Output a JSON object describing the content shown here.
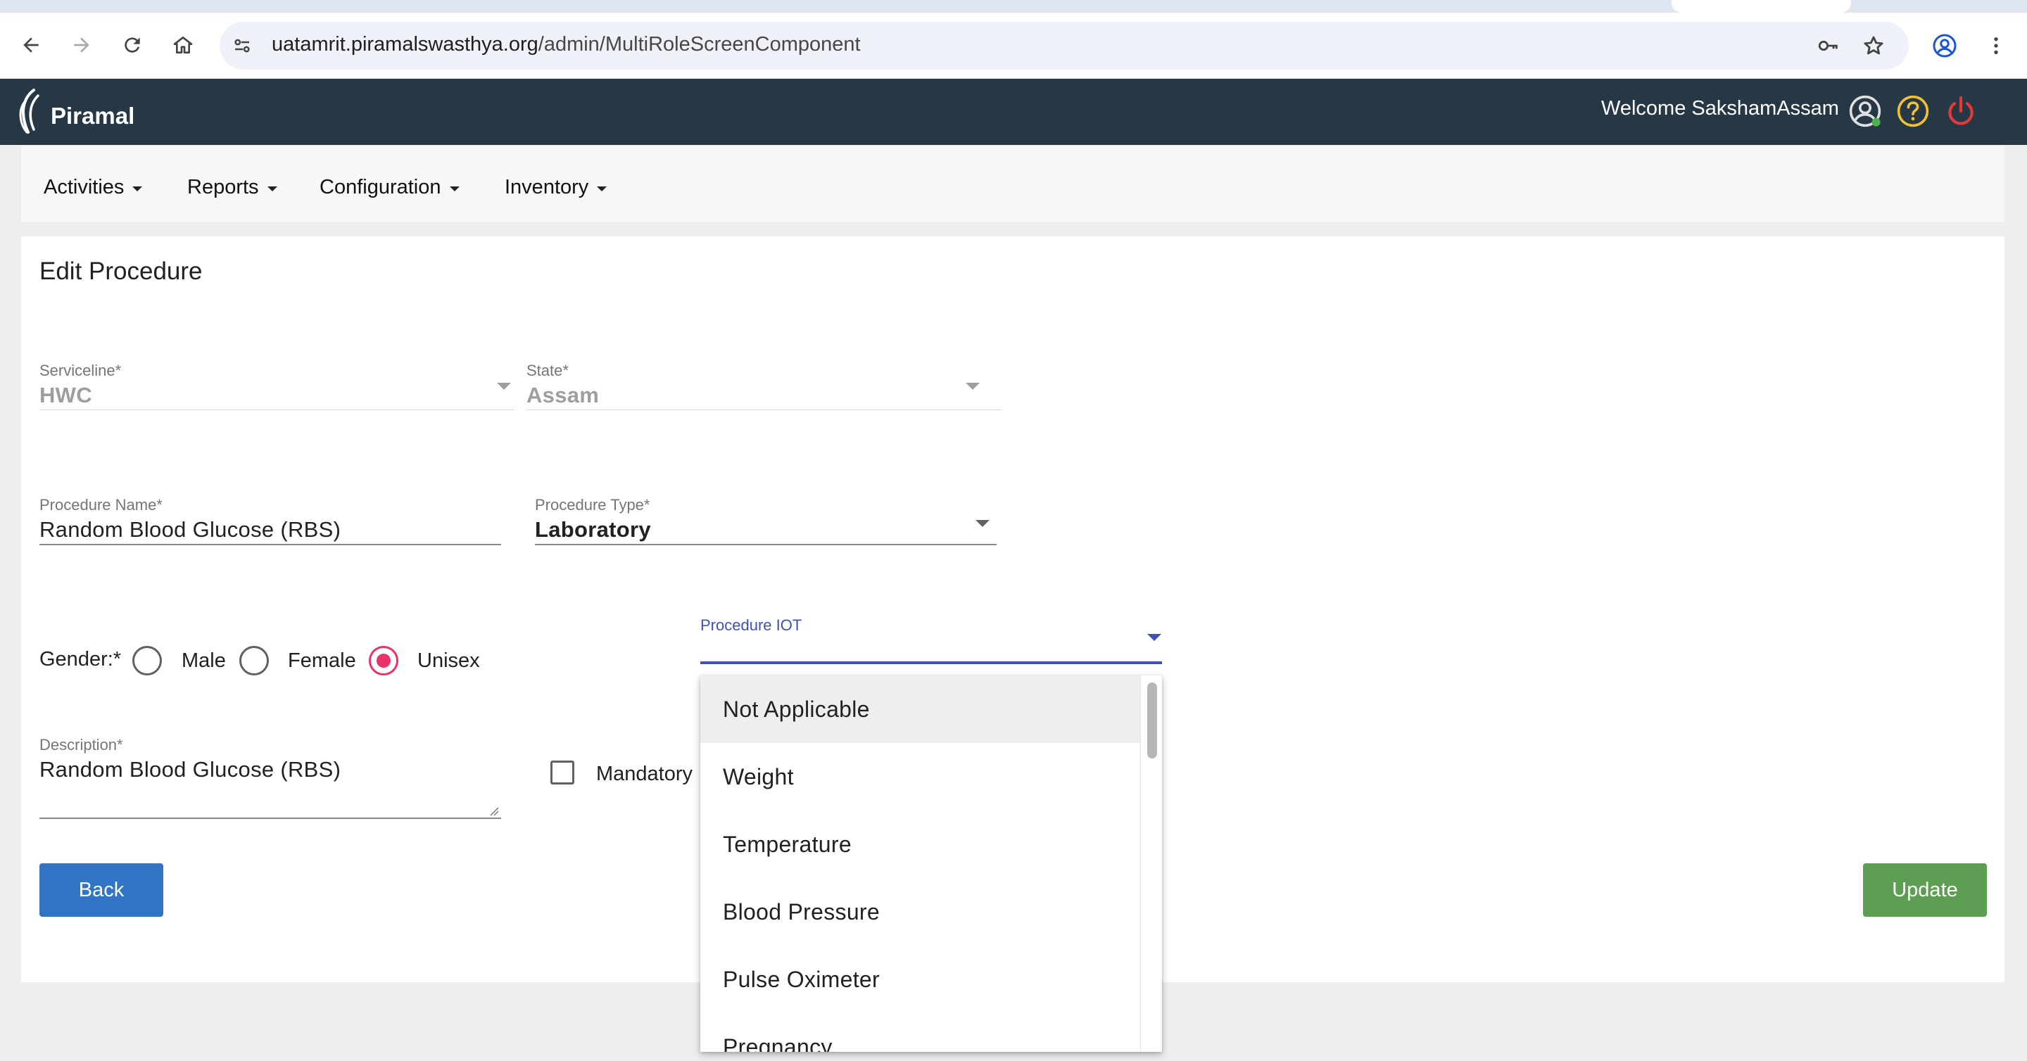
{
  "browser": {
    "url_host": "uatamrit.piramalswasthya.org",
    "url_path": "/admin/MultiRoleScreenComponent"
  },
  "header": {
    "logo_text": "Piramal",
    "welcome_text": "Welcome SakshamAssam"
  },
  "menu": {
    "items": [
      {
        "label": "Activities"
      },
      {
        "label": "Reports"
      },
      {
        "label": "Configuration"
      },
      {
        "label": "Inventory"
      }
    ]
  },
  "form": {
    "title": "Edit Procedure",
    "serviceline": {
      "label": "Serviceline*",
      "value": "HWC"
    },
    "state": {
      "label": "State*",
      "value": "Assam"
    },
    "procedure_name": {
      "label": "Procedure Name*",
      "value": "Random Blood Glucose (RBS)"
    },
    "procedure_type": {
      "label": "Procedure Type*",
      "value": "Laboratory"
    },
    "gender": {
      "label": "Gender:*",
      "options": [
        {
          "label": "Male",
          "selected": false
        },
        {
          "label": "Female",
          "selected": false
        },
        {
          "label": "Unisex",
          "selected": true
        }
      ]
    },
    "procedure_iot": {
      "label": "Procedure IOT",
      "value": ""
    },
    "description": {
      "label": "Description*",
      "value": "Random Blood Glucose (RBS)"
    },
    "mandatory": {
      "label": "Mandatory",
      "checked": false
    },
    "back_label": "Back",
    "update_label": "Update"
  },
  "iot_dropdown": {
    "options": [
      "Not Applicable",
      "Weight",
      "Temperature",
      "Blood Pressure",
      "Pulse Oximeter",
      "Pregnancy"
    ],
    "highlighted": "Not Applicable"
  },
  "colors": {
    "header_bg": "#263746",
    "primary_blue": "#3174c6",
    "update_green": "#5c9e52",
    "radio_accent": "#e8336a",
    "focus_indigo": "#3f51b5",
    "help_icon": "#f2c12e",
    "power_icon": "#e53935"
  }
}
